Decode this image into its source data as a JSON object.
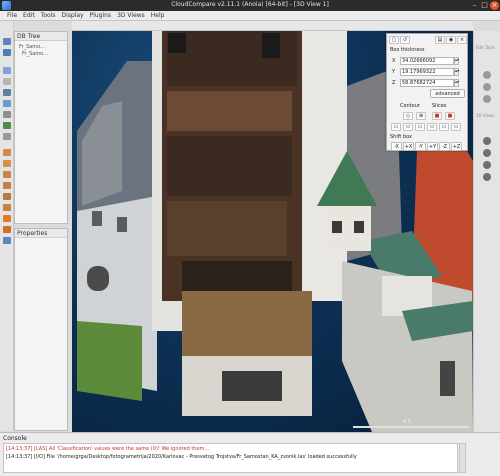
{
  "window": {
    "title": "CloudCompare v2.11.1 (Anoia) [64-bit] - [3D View 1]"
  },
  "menu": [
    "File",
    "Edit",
    "Tools",
    "Display",
    "Plugins",
    "3D Views",
    "Help"
  ],
  "panels": {
    "db_tree_title": "DB Tree",
    "db_tree_items": [
      "Fr_Samo...",
      "Fr_Samo..."
    ],
    "properties_title": "Properties"
  },
  "clipping_box": {
    "box_thickness_label": "Box thickness",
    "x_label": "X",
    "x_value": "34.02666092",
    "y_label": "Y",
    "y_value": "19.17969322",
    "z_label": "Z",
    "z_value": "58.87682724",
    "advanced_label": "advanced",
    "contour_label": "Contour",
    "slices_label": "Slices",
    "shift_box_label": "Shift box",
    "shift_buttons": [
      "-X",
      "+X",
      "-Y",
      "+Y",
      "-Z",
      "+Z"
    ]
  },
  "viewport": {
    "scale_value": "4.5",
    "background_color": "#0d3358"
  },
  "console": {
    "title": "Console",
    "lines": [
      "[14:13:37] [LAS] All 'Classification' values were the same (0)! We ignored them...",
      "[14:13:37] [I/O] File '/home/grga/Desktop/fotogrametrija/2020/Karlovac - Presvetog Trojstva/Fr_Samostan_KA_zvonik.las' loaded successfully"
    ],
    "warning_color": "#c0392b"
  },
  "right_toolbar_labels": [
    "Edit Tools",
    "3D Views"
  ]
}
